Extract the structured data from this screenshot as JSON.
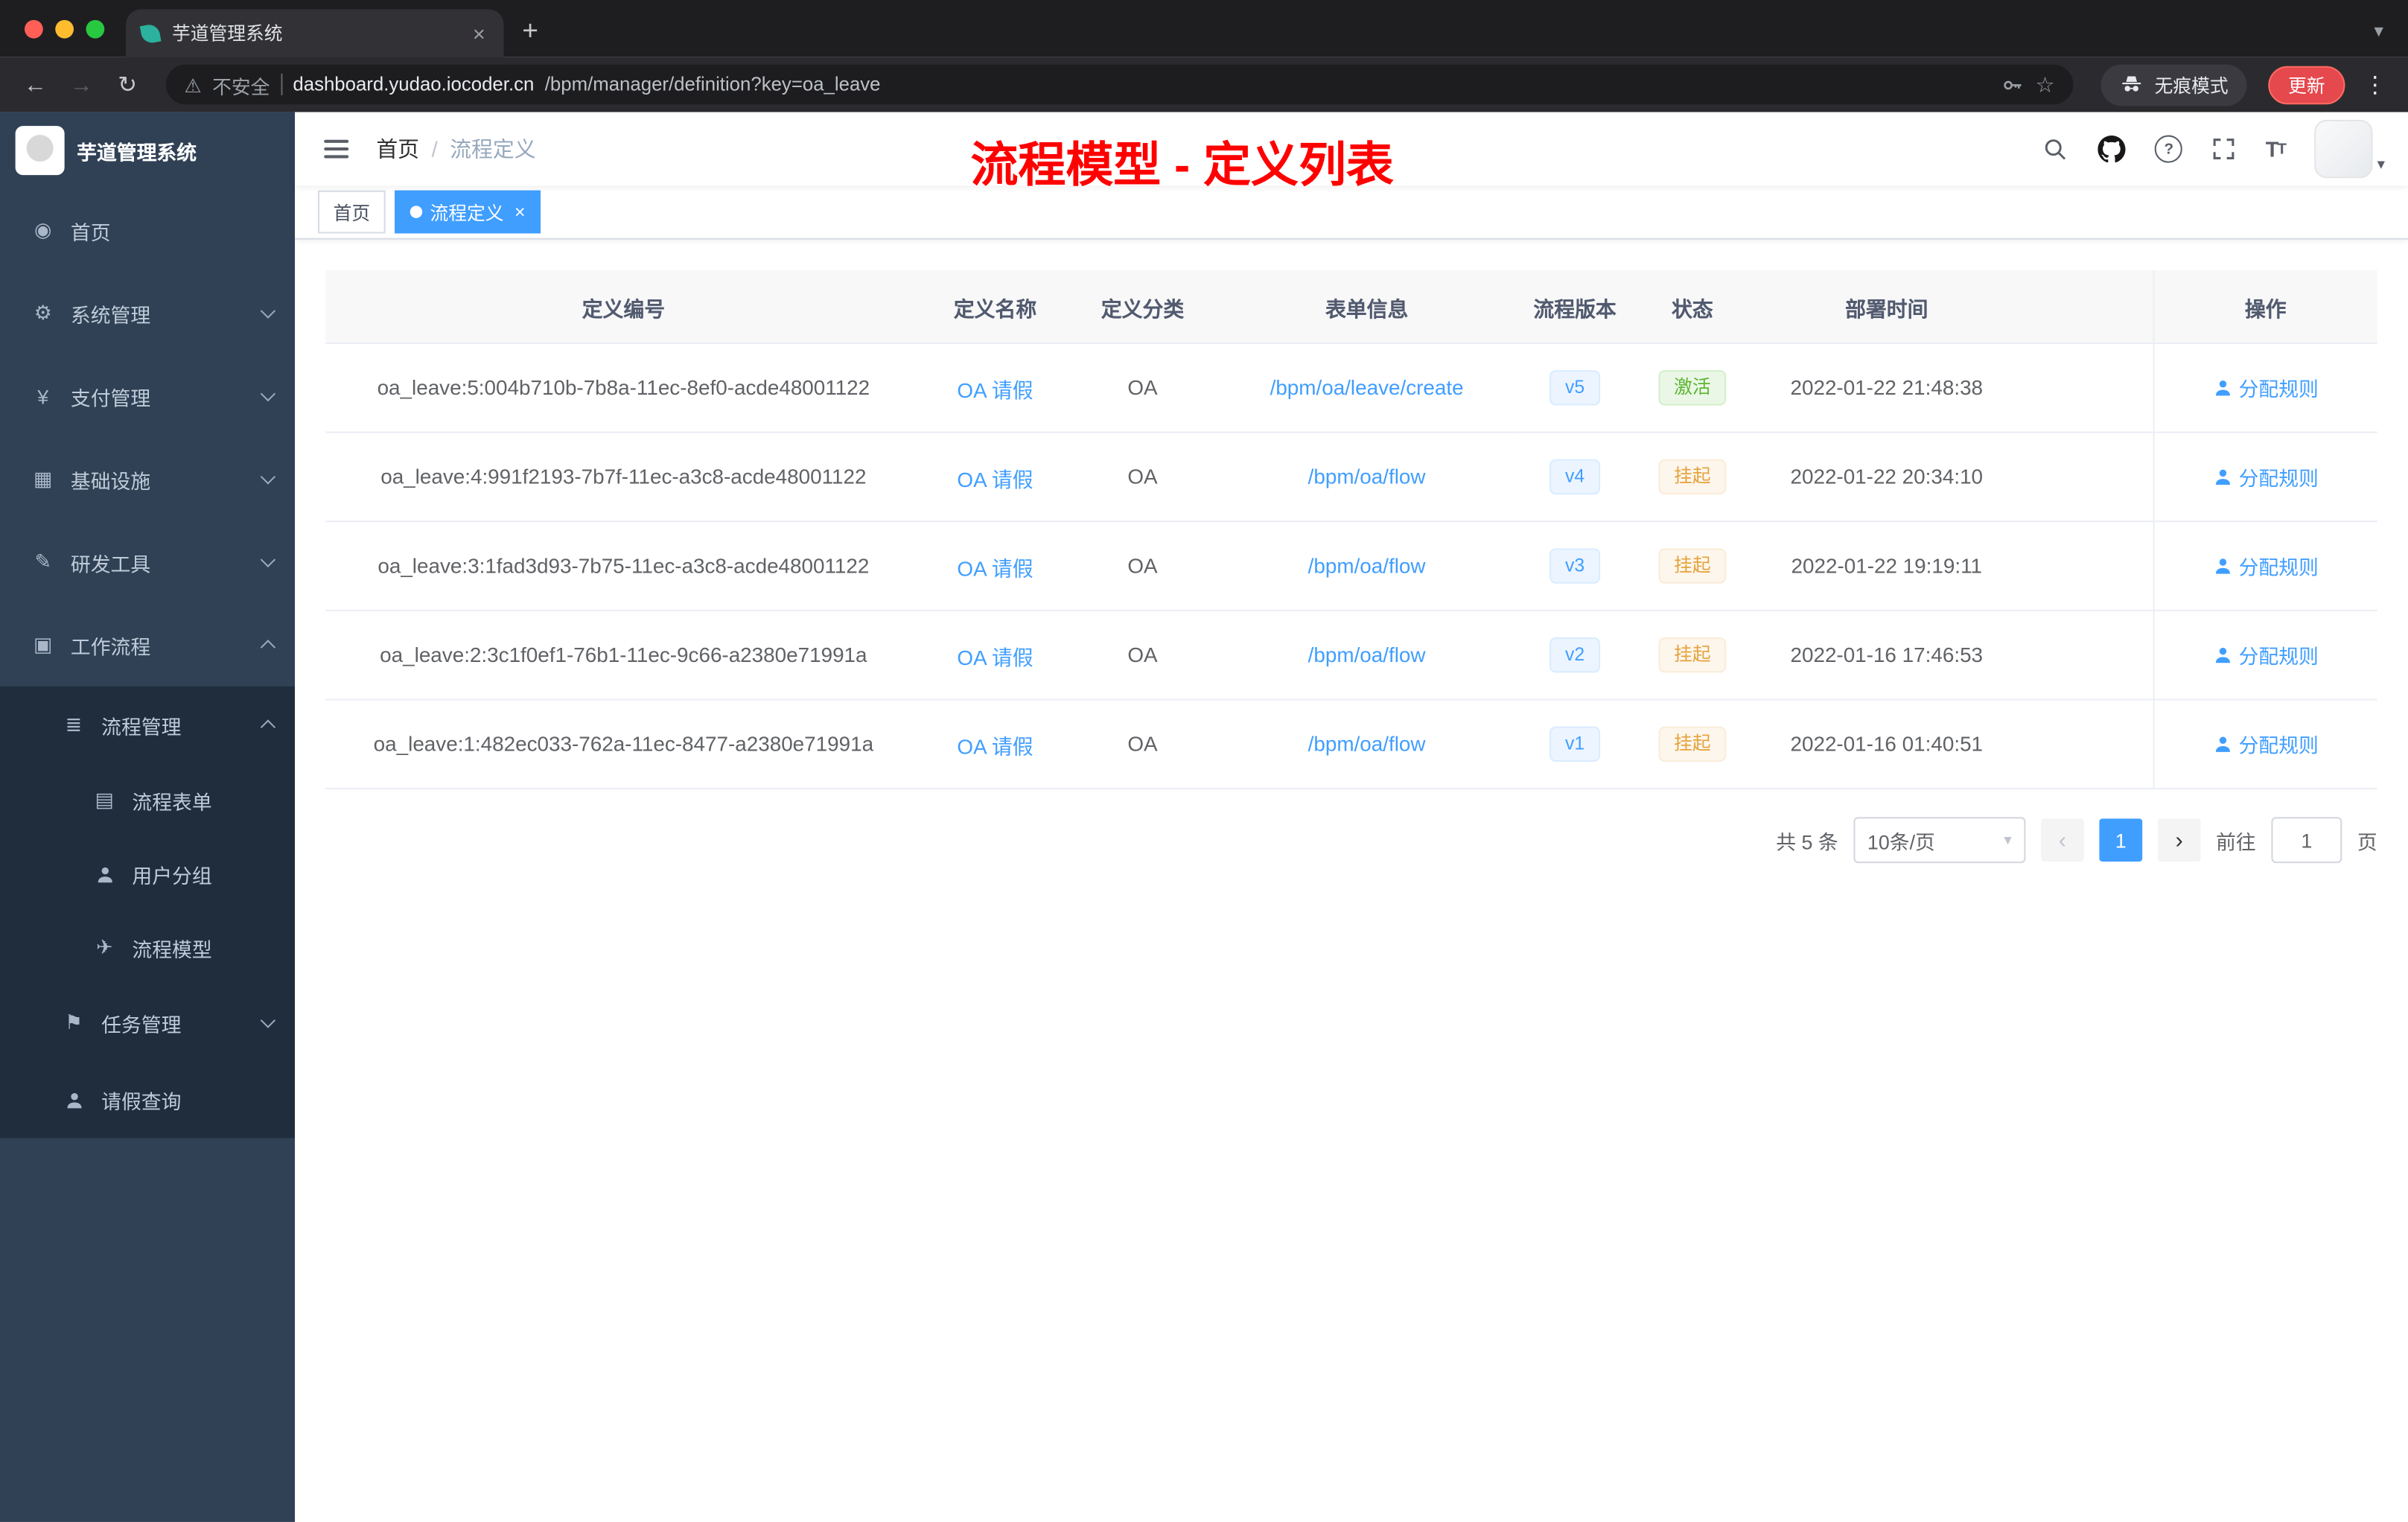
{
  "browser": {
    "tab": {
      "title": "芋道管理系统"
    },
    "url": {
      "security": "不安全",
      "host": "dashboard.yudao.iocoder.cn",
      "path": "/bpm/manager/definition?key=oa_leave"
    },
    "incognito": "无痕模式",
    "update": "更新"
  },
  "sidebar": {
    "title": "芋道管理系统",
    "items": [
      {
        "key": "home",
        "label": "首页",
        "icon": "dashboard-icon",
        "level": 1
      },
      {
        "key": "system",
        "label": "系统管理",
        "icon": "gear-icon",
        "level": 1,
        "chevron": "down"
      },
      {
        "key": "payment",
        "label": "支付管理",
        "icon": "yen-icon",
        "level": 1,
        "chevron": "down"
      },
      {
        "key": "infrastructure",
        "label": "基础设施",
        "icon": "infrastructure-icon",
        "level": 1,
        "chevron": "down"
      },
      {
        "key": "dev-tools",
        "label": "研发工具",
        "icon": "dev-tools-icon",
        "level": 1,
        "chevron": "down"
      },
      {
        "key": "workflow",
        "label": "工作流程",
        "icon": "workflow-icon",
        "level": 1,
        "chevron": "up"
      }
    ],
    "submenu_items": [
      {
        "key": "process-management",
        "label": "流程管理",
        "icon": "process-management-icon",
        "level": 2,
        "chevron": "up"
      },
      {
        "key": "process-form",
        "label": "流程表单",
        "icon": "process-form-icon",
        "level": 3
      },
      {
        "key": "user-group",
        "label": "用户分组",
        "icon": "user-group-icon",
        "level": 3
      },
      {
        "key": "process-model",
        "label": "流程模型",
        "icon": "process-model-icon",
        "level": 3
      },
      {
        "key": "task-management",
        "label": "任务管理",
        "icon": "task-management-icon",
        "level": 2,
        "chevron": "down"
      },
      {
        "key": "leave-query",
        "label": "请假查询",
        "icon": "leave-query-icon",
        "level": 2
      }
    ]
  },
  "topbar": {
    "breadcrumb": [
      "首页",
      "流程定义"
    ]
  },
  "annotation": "流程模型 - 定义列表",
  "tags": [
    {
      "label": "首页",
      "active": false
    },
    {
      "label": "流程定义",
      "active": true
    }
  ],
  "table": {
    "columns": [
      "定义编号",
      "定义名称",
      "定义分类",
      "表单信息",
      "流程版本",
      "状态",
      "部署时间",
      "操作"
    ],
    "rows": [
      {
        "id": "oa_leave:5:004b710b-7b8a-11ec-8ef0-acde48001122",
        "name": "OA 请假",
        "category": "OA",
        "form": "/bpm/oa/leave/create",
        "version": "v5",
        "status": "激活",
        "status_type": "success",
        "deploy_time": "2022-01-22 21:48:38",
        "action": "分配规则"
      },
      {
        "id": "oa_leave:4:991f2193-7b7f-11ec-a3c8-acde48001122",
        "name": "OA 请假",
        "category": "OA",
        "form": "/bpm/oa/flow",
        "version": "v4",
        "status": "挂起",
        "status_type": "warning",
        "deploy_time": "2022-01-22 20:34:10",
        "action": "分配规则"
      },
      {
        "id": "oa_leave:3:1fad3d93-7b75-11ec-a3c8-acde48001122",
        "name": "OA 请假",
        "category": "OA",
        "form": "/bpm/oa/flow",
        "version": "v3",
        "status": "挂起",
        "status_type": "warning",
        "deploy_time": "2022-01-22 19:19:11",
        "action": "分配规则"
      },
      {
        "id": "oa_leave:2:3c1f0ef1-76b1-11ec-9c66-a2380e71991a",
        "name": "OA 请假",
        "category": "OA",
        "form": "/bpm/oa/flow",
        "version": "v2",
        "status": "挂起",
        "status_type": "warning",
        "deploy_time": "2022-01-16 17:46:53",
        "action": "分配规则"
      },
      {
        "id": "oa_leave:1:482ec033-762a-11ec-8477-a2380e71991a",
        "name": "OA 请假",
        "category": "OA",
        "form": "/bpm/oa/flow",
        "version": "v1",
        "status": "挂起",
        "status_type": "warning",
        "deploy_time": "2022-01-16 01:40:51",
        "action": "分配规则"
      }
    ]
  },
  "pagination": {
    "total": "共 5 条",
    "page_size": "10条/页",
    "current": "1",
    "goto_prefix": "前往",
    "goto_value": "1",
    "goto_suffix": "页"
  }
}
